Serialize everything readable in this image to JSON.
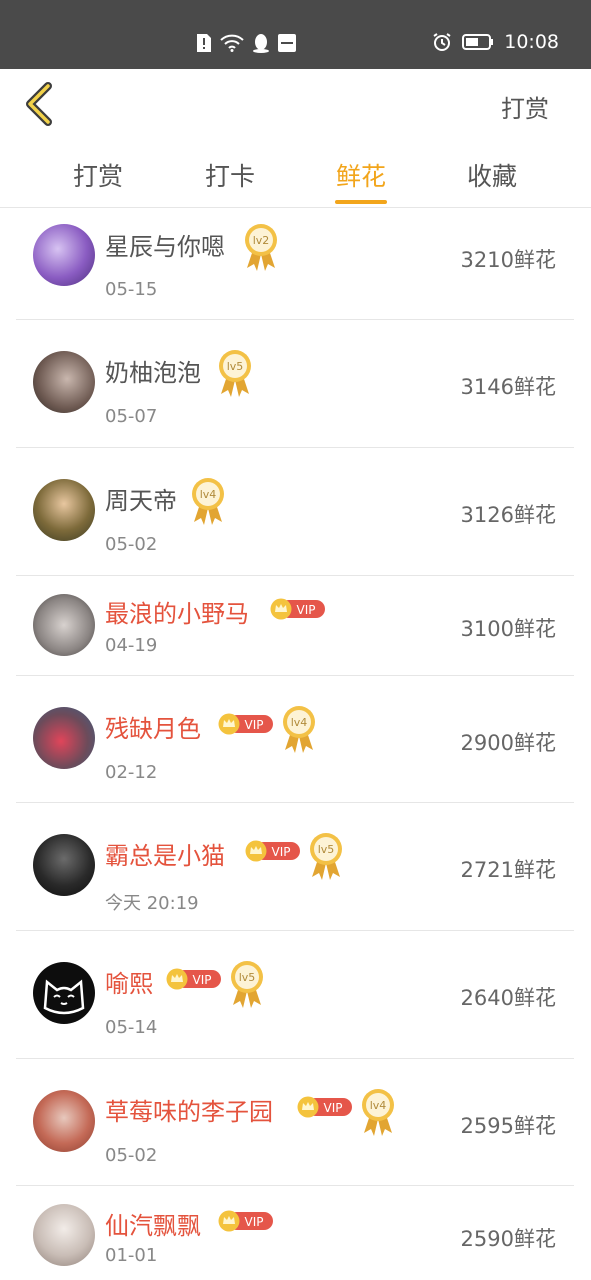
{
  "status_bar": {
    "time": "10:08"
  },
  "header": {
    "back_icon": "chevron-left-icon",
    "action_label": "打赏"
  },
  "tabs": [
    {
      "label": "打赏",
      "active": false
    },
    {
      "label": "打卡",
      "active": false
    },
    {
      "label": "鲜花",
      "active": true
    },
    {
      "label": "收藏",
      "active": false
    }
  ],
  "list": [
    {
      "name": "星辰与你嗯",
      "date": "05-15",
      "amount": "3210鲜花",
      "vip": false,
      "level": "lv2"
    },
    {
      "name": "奶柚泡泡",
      "date": "05-07",
      "amount": "3146鲜花",
      "vip": false,
      "level": "lv5"
    },
    {
      "name": "周天帝",
      "date": "05-02",
      "amount": "3126鲜花",
      "vip": false,
      "level": "lv4"
    },
    {
      "name": "最浪的小野马",
      "date": "04-19",
      "amount": "3100鲜花",
      "vip": true,
      "vip_label": "VIP",
      "level": ""
    },
    {
      "name": "残缺月色",
      "date": "02-12",
      "amount": "2900鲜花",
      "vip": true,
      "vip_label": "VIP",
      "level": "lv4"
    },
    {
      "name": "霸总是小猫",
      "date": "今天 20:19",
      "amount": "2721鲜花",
      "vip": true,
      "vip_label": "VIP",
      "level": "lv5"
    },
    {
      "name": "喻熙",
      "date": "05-14",
      "amount": "2640鲜花",
      "vip": true,
      "vip_label": "VIP",
      "level": "lv5"
    },
    {
      "name": "草莓味的李子园",
      "date": "05-02",
      "amount": "2595鲜花",
      "vip": true,
      "vip_label": "VIP",
      "level": "lv4"
    },
    {
      "name": "仙汽飘飘",
      "date": "01-01",
      "amount": "2590鲜花",
      "vip": true,
      "vip_label": "VIP",
      "level": ""
    }
  ],
  "colors": {
    "accent": "#f2a51b",
    "vip_name": "#e4533d",
    "status_bar": "#4a4a4a"
  }
}
